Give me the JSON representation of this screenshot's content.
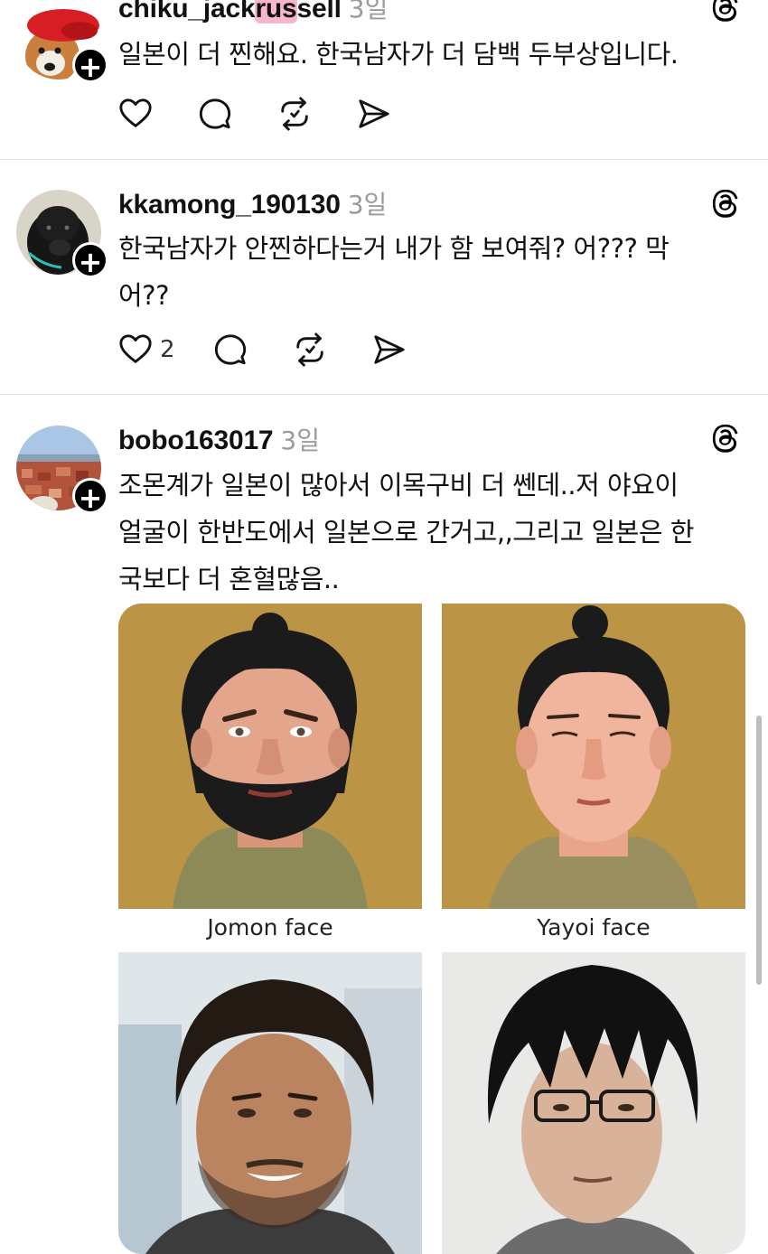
{
  "posts": [
    {
      "username_parts": [
        "chiku_jack",
        "rus",
        "sell"
      ],
      "time": "3일",
      "text": "일본이 더 찐해요. 한국남자가 더 담백 두부상입니다.",
      "like_count": ""
    },
    {
      "username": "kkamong_190130",
      "time": "3일",
      "text_lines": [
        "한국남자가 안찐하다는거 내가 함 보여줘? 어??? 막",
        "어??"
      ],
      "like_count": "2"
    },
    {
      "username": "bobo163017",
      "time": "3일",
      "text_lines": [
        "조몬계가 일본이 많아서 이목구비 더 쎈데..저 야요이",
        "얼굴이 한반도에서 일본으로 간거고,,그리고 일본은 한",
        "국보다 더 혼혈많음.."
      ],
      "image_captions": [
        "Jomon face",
        "Yayoi face"
      ]
    }
  ],
  "icons": {
    "follow": "plus-icon",
    "platform": "threads-icon",
    "like": "heart-icon",
    "reply": "comment-icon",
    "repost": "repost-icon",
    "share": "send-icon"
  },
  "follow_symbol": "+",
  "colors": {
    "username_highlight": "#f7b6c9",
    "divider": "#e3e3e3",
    "time": "#9a9a9a"
  }
}
